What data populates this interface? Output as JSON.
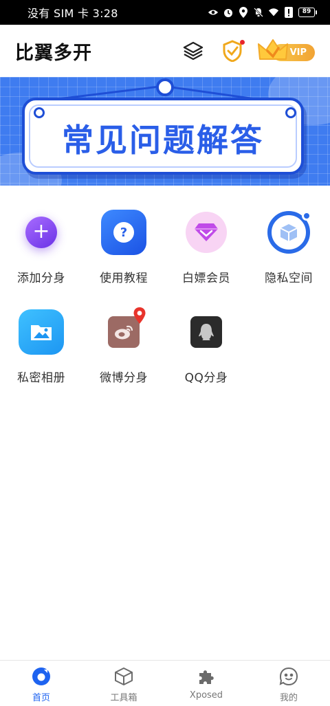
{
  "status_bar": {
    "carrier_time": "没有 SIM 卡 3:28",
    "battery": "89"
  },
  "header": {
    "title": "比翼多开",
    "vip_label": "VIP",
    "icons": [
      "layers-icon",
      "shield-icon",
      "crown-icon"
    ]
  },
  "banner": {
    "title": "常见问题解答"
  },
  "features": [
    {
      "label": "添加分身",
      "icon": "add-icon"
    },
    {
      "label": "使用教程",
      "icon": "question-icon"
    },
    {
      "label": "白嫖会员",
      "icon": "diamond-icon"
    },
    {
      "label": "隐私空间",
      "icon": "cube-icon"
    },
    {
      "label": "私密相册",
      "icon": "folder-image-icon"
    },
    {
      "label": "微博分身",
      "icon": "weibo-icon"
    },
    {
      "label": "QQ分身",
      "icon": "qq-icon"
    }
  ],
  "bottom_nav": [
    {
      "label": "首页",
      "icon": "home-icon",
      "active": true
    },
    {
      "label": "工具箱",
      "icon": "box-icon",
      "active": false
    },
    {
      "label": "Xposed",
      "icon": "puzzle-icon",
      "active": false
    },
    {
      "label": "我的",
      "icon": "face-icon",
      "active": false
    }
  ],
  "colors": {
    "accent": "#1e63f0",
    "banner_bg": "#3f7cf0",
    "notification_dot": "#e8262c"
  }
}
